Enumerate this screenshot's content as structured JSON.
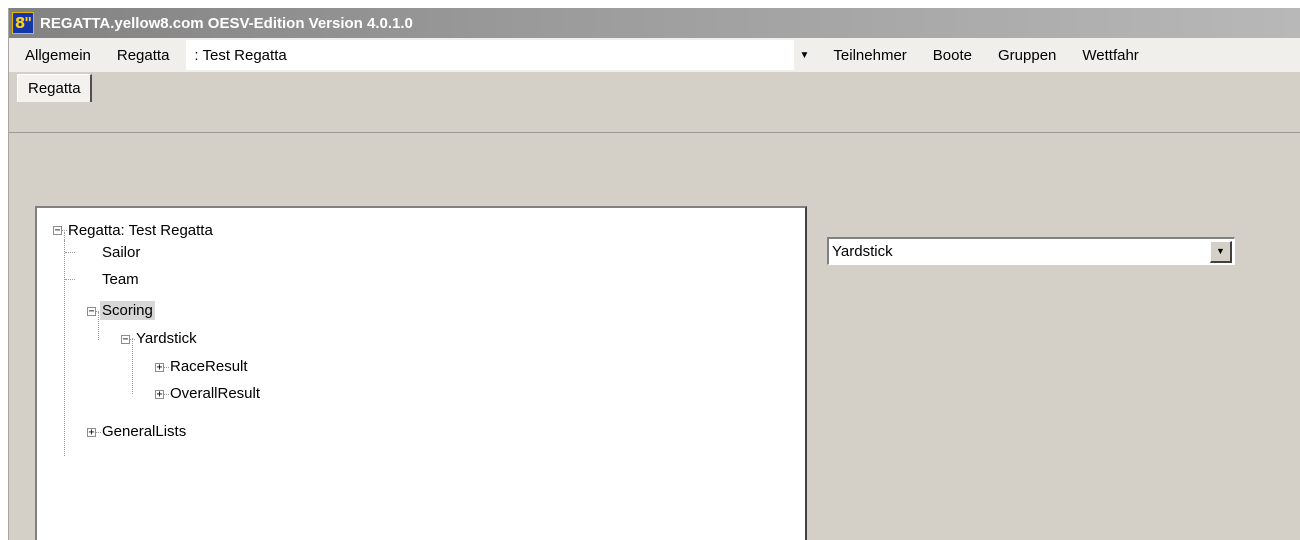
{
  "window": {
    "title": "REGATTA.yellow8.com OESV-Edition Version 4.0.1.0",
    "icon_text": "8\""
  },
  "menu": {
    "allgemein": "Allgemein",
    "regatta": "Regatta",
    "regatta_select_value": ":  Test Regatta",
    "teilnehmer": "Teilnehmer",
    "boote": "Boote",
    "gruppen": "Gruppen",
    "wettfahr": "Wettfahr"
  },
  "tabs": {
    "regatta": "Regatta"
  },
  "tree": {
    "root": "Regatta: Test Regatta",
    "sailor": "Sailor",
    "team": "Team",
    "scoring": "Scoring",
    "yardstick": "Yardstick",
    "race_result": "RaceResult",
    "overall_result": "OverallResult",
    "general_lists": "GeneralLists"
  },
  "scoring_select": {
    "value": "Yardstick"
  },
  "icons": {
    "app": "yellow8-app-icon",
    "dropdown": "chevron-down-icon",
    "expand": "plus-box-icon",
    "collapse": "minus-box-icon"
  }
}
